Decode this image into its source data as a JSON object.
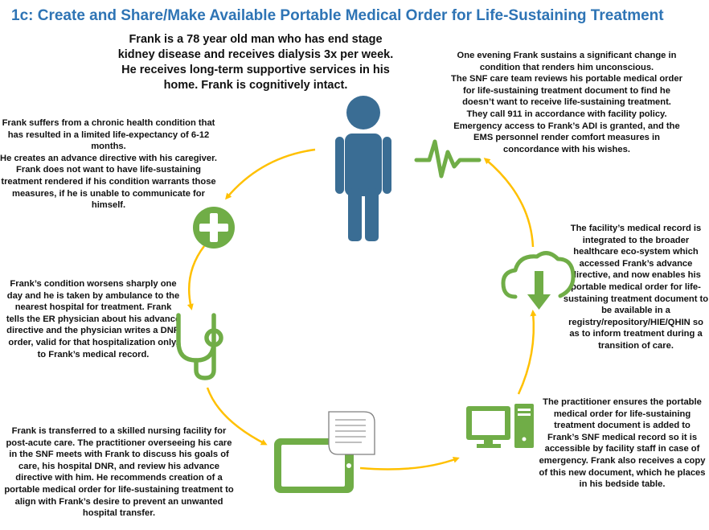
{
  "title": "1c:  Create and Share/Make Available Portable Medical Order for Life-Sustaining Treatment",
  "intro": "Frank is a 78 year old man who has end stage kidney disease and receives dialysis 3x per week. He receives long-term supportive services in his home.  Frank is cognitively intact.",
  "steps": {
    "chronic": "Frank suffers from a chronic health condition that has resulted in a limited life-expectancy of 6-12 months.\nHe creates an advance directive with his caregiver.\nFrank does not want to have life-sustaining treatment rendered if his condition warrants those measures, if he is unable to communicate for himself.",
    "worsens": "Frank’s condition worsens sharply one day and he is taken by ambulance to the nearest hospital for treatment.  Frank tells the ER physician about his advance directive and the physician writes a DNR order, valid for that hospitalization only, to Frank’s medical record.",
    "snf": "Frank is transferred to a skilled nursing facility for post-acute care.  The practitioner overseeing his care in the SNF meets with Frank to discuss his goals of care, his hospital DNR, and review his advance directive with him.  He recommends creation of a portable medical order for life-sustaining treatment to align with Frank’s desire to prevent an unwanted hospital transfer.",
    "practitioner": "The practitioner ensures the portable medical order for life-sustaining treatment document is added to Frank’s SNF medical record so it is accessible by facility staff in case of emergency.  Frank also receives a copy of this new document, which he places in his bedside table.",
    "record": "The facility’s medical record is integrated to the broader healthcare eco-system which accessed Frank’s advance directive, and now enables his portable medical order for life-sustaining treatment document to be available in a registry/repository/HIE/QHIN so as to inform treatment during a transition of care.",
    "evening": "One evening Frank sustains a significant change in condition that renders him unconscious.\nThe SNF care team reviews his portable medical order for life-sustaining treatment document to find he doesn’t want to receive life-sustaining treatment.\nThey call 911 in accordance with facility policy.\nEmergency access to Frank’s ADI is granted, and the EMS personnel render comfort measures in concordance with his wishes."
  },
  "icons": [
    "person-icon",
    "heartbeat-icon",
    "medical-cross-icon",
    "stethoscope-icon",
    "tablet-icon",
    "document-icon",
    "desktop-computer-icon",
    "cloud-download-icon"
  ],
  "colors": {
    "title": "#2E74B5",
    "person": "#3A6D94",
    "green": "#70AD47",
    "arrow": "#FFC000"
  }
}
